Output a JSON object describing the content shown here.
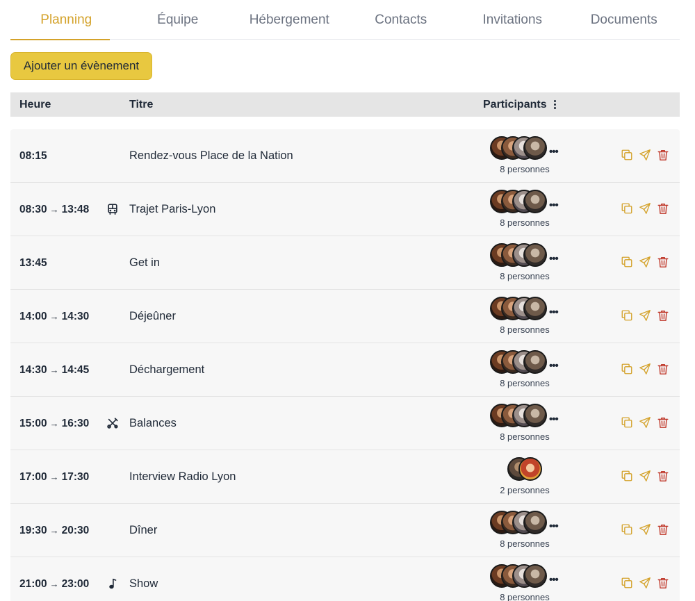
{
  "tabs": [
    {
      "label": "Planning",
      "active": true
    },
    {
      "label": "Équipe",
      "active": false
    },
    {
      "label": "Hébergement",
      "active": false
    },
    {
      "label": "Contacts",
      "active": false
    },
    {
      "label": "Invitations",
      "active": false
    },
    {
      "label": "Documents",
      "active": false
    }
  ],
  "add_button": "Ajouter un évènement",
  "table": {
    "headers": {
      "heure": "Heure",
      "titre": "Titre",
      "participants": "Participants"
    }
  },
  "colors": {
    "accent": "#d4a22a",
    "button": "#e8c840",
    "delete": "#c0392b"
  },
  "events": [
    {
      "start": "08:15",
      "end": "",
      "icon": "",
      "title": "Rendez-vous Place de la Nation",
      "participants": "8 personnes",
      "avatars": 4,
      "more": true
    },
    {
      "start": "08:30",
      "end": "13:48",
      "icon": "bus-icon",
      "title": "Trajet Paris-Lyon",
      "participants": "8 personnes",
      "avatars": 4,
      "more": true
    },
    {
      "start": "13:45",
      "end": "",
      "icon": "",
      "title": "Get in",
      "participants": "8 personnes",
      "avatars": 4,
      "more": true
    },
    {
      "start": "14:00",
      "end": "14:30",
      "icon": "",
      "title": "Déjeûner",
      "participants": "8 personnes",
      "avatars": 4,
      "more": true
    },
    {
      "start": "14:30",
      "end": "14:45",
      "icon": "",
      "title": "Déchargement",
      "participants": "8 personnes",
      "avatars": 4,
      "more": true
    },
    {
      "start": "15:00",
      "end": "16:30",
      "icon": "tools-icon",
      "title": "Balances",
      "participants": "8 personnes",
      "avatars": 4,
      "more": true
    },
    {
      "start": "17:00",
      "end": "17:30",
      "icon": "",
      "title": "Interview Radio Lyon",
      "participants": "2 personnes",
      "avatars": 2,
      "more": false
    },
    {
      "start": "19:30",
      "end": "20:30",
      "icon": "",
      "title": "Dîner",
      "participants": "8 personnes",
      "avatars": 4,
      "more": true
    },
    {
      "start": "21:00",
      "end": "23:00",
      "icon": "music-note-icon",
      "title": "Show",
      "participants": "8 personnes",
      "avatars": 4,
      "more": true
    }
  ]
}
